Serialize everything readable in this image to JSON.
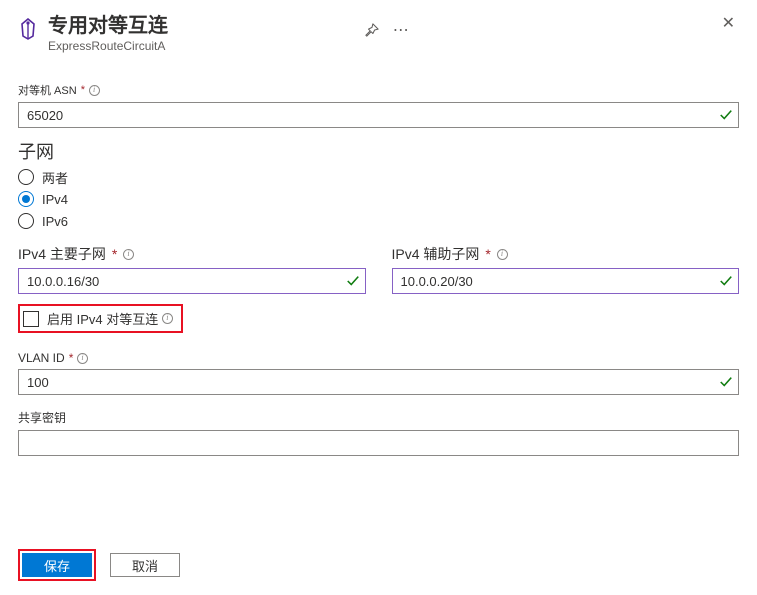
{
  "header": {
    "title": "专用对等互连",
    "subtitle": "ExpressRouteCircuitA"
  },
  "fields": {
    "peer_asn": {
      "label": "对等机 ASN",
      "value": "65020"
    },
    "subnets_section": "子网",
    "radio": {
      "both": "两者",
      "ipv4": "IPv4",
      "ipv6": "IPv6"
    },
    "ipv4_primary": {
      "label": "IPv4 主要子网",
      "value": "10.0.0.16/30"
    },
    "ipv4_secondary": {
      "label": "IPv4 辅助子网",
      "value": "10.0.0.20/30"
    },
    "enable_ipv4_peering": "启用 IPv4 对等互连",
    "vlan_id": {
      "label": "VLAN ID",
      "value": "100"
    },
    "shared_key": {
      "label": "共享密钥",
      "value": ""
    }
  },
  "buttons": {
    "save": "保存",
    "cancel": "取消"
  }
}
